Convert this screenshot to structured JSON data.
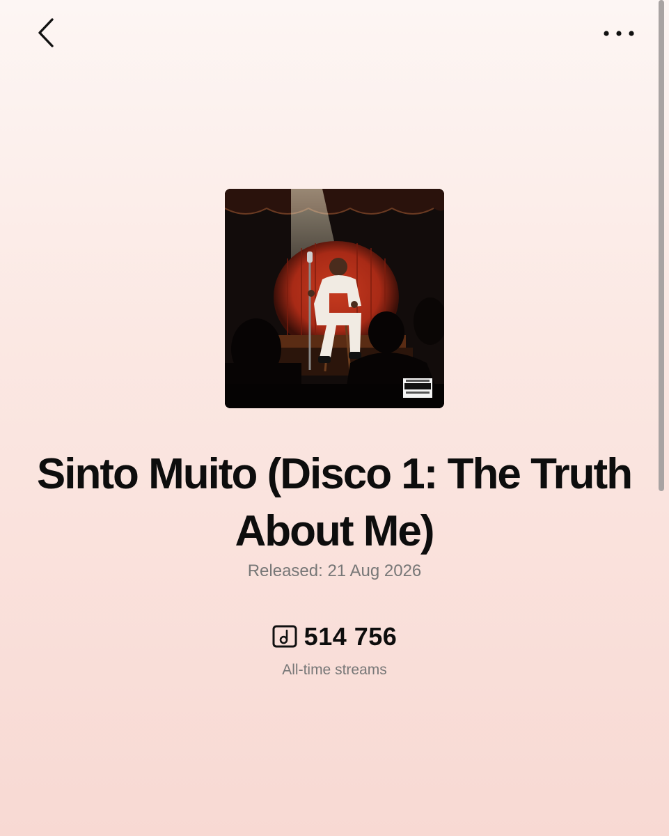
{
  "header": {
    "back_icon": "chevron-left-icon",
    "more_icon": "more-horizontal-icon"
  },
  "album": {
    "title": "Sinto Muito (Disco 1: The Truth About Me)",
    "released": "Released: 21 Aug 2026",
    "cover_badge": "PARENTAL ADVISORY EXPLICIT CONTENT",
    "cover_colors": {
      "curtain": "#b8301a",
      "stage_dark": "#120c0b",
      "outfit": "#f1ebe3"
    }
  },
  "stats": {
    "streams_icon": "music-note-icon",
    "streams_count": "514 756",
    "streams_label": "All-time streams"
  }
}
